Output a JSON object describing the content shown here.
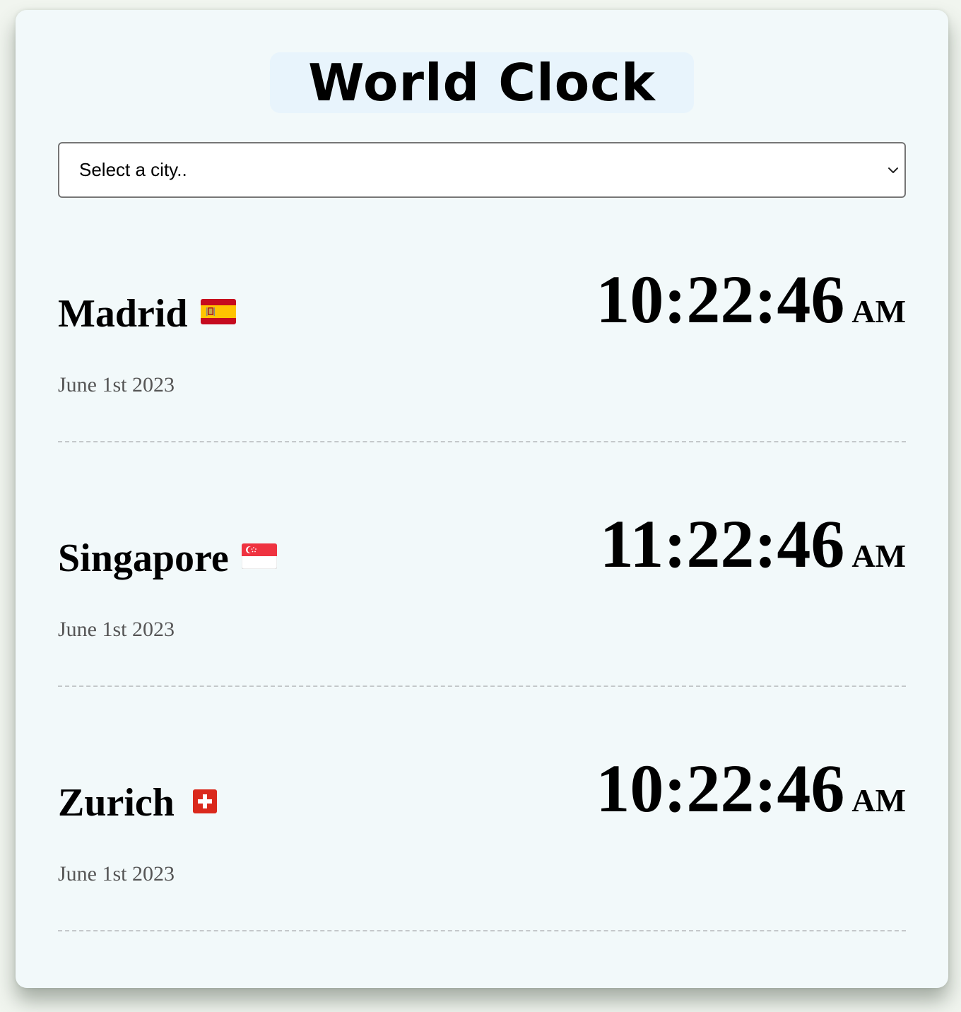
{
  "header": {
    "title": "World Clock"
  },
  "city_select": {
    "selected_label": "Select a city.."
  },
  "cities": [
    {
      "name": "Madrid",
      "flag": "spain-flag-icon",
      "date": "June 1st 2023",
      "time": "10:22:46",
      "period": "AM"
    },
    {
      "name": "Singapore",
      "flag": "singapore-flag-icon",
      "date": "June 1st 2023",
      "time": "11:22:46",
      "period": "AM"
    },
    {
      "name": "Zurich",
      "flag": "switzerland-flag-icon",
      "date": "June 1st 2023",
      "time": "10:22:46",
      "period": "AM"
    }
  ],
  "colors": {
    "page_background": "#f1f5ef",
    "card_background": "#f2f9fa",
    "title_background": "#e8f4fc",
    "date_text": "#555555",
    "divider": "#c4c8ca"
  }
}
